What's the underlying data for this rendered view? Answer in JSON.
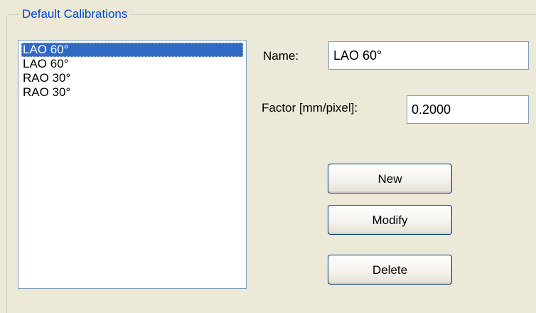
{
  "group": {
    "title": "Default Calibrations"
  },
  "calibrations": {
    "items": [
      {
        "label": "LAO 60°",
        "selected": true
      },
      {
        "label": "LAO 60°",
        "selected": false
      },
      {
        "label": "RAO 30°",
        "selected": false
      },
      {
        "label": "RAO 30°",
        "selected": false
      }
    ]
  },
  "form": {
    "name_label": "Name:",
    "name_value": "LAO 60°",
    "factor_label": "Factor [mm/pixel]:",
    "factor_value": "0.2000"
  },
  "buttons": {
    "new_label": "New",
    "modify_label": "Modify",
    "delete_label": "Delete"
  },
  "colors": {
    "background": "#ece9d8",
    "legend_text": "#0046d5",
    "selection": "#316ac5",
    "input_border": "#7f9db9",
    "button_border": "#003c74"
  }
}
